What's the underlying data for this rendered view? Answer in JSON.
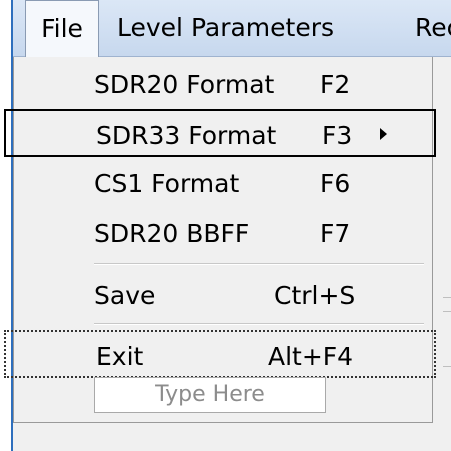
{
  "menubar": {
    "items": [
      {
        "label": "File"
      },
      {
        "label": "Level Parameters"
      },
      {
        "label": "Rec"
      }
    ]
  },
  "file_menu": {
    "items": [
      {
        "label": "SDR20 Format",
        "shortcut": "F2"
      },
      {
        "label": "SDR33 Format",
        "shortcut": "F3",
        "has_submenu": true
      },
      {
        "label": "CS1 Format",
        "shortcut": "F6"
      },
      {
        "label": "SDR20 BBFF",
        "shortcut": "F7"
      },
      {
        "label": "Save",
        "shortcut": "Ctrl+S"
      },
      {
        "label": "Exit",
        "shortcut": "Alt+F4"
      }
    ],
    "type_here": "Type Here"
  },
  "colors": {
    "window_border": "#2e6fbd",
    "menubar": "#c7d8ee",
    "menu_background": "#f0f0f0"
  }
}
